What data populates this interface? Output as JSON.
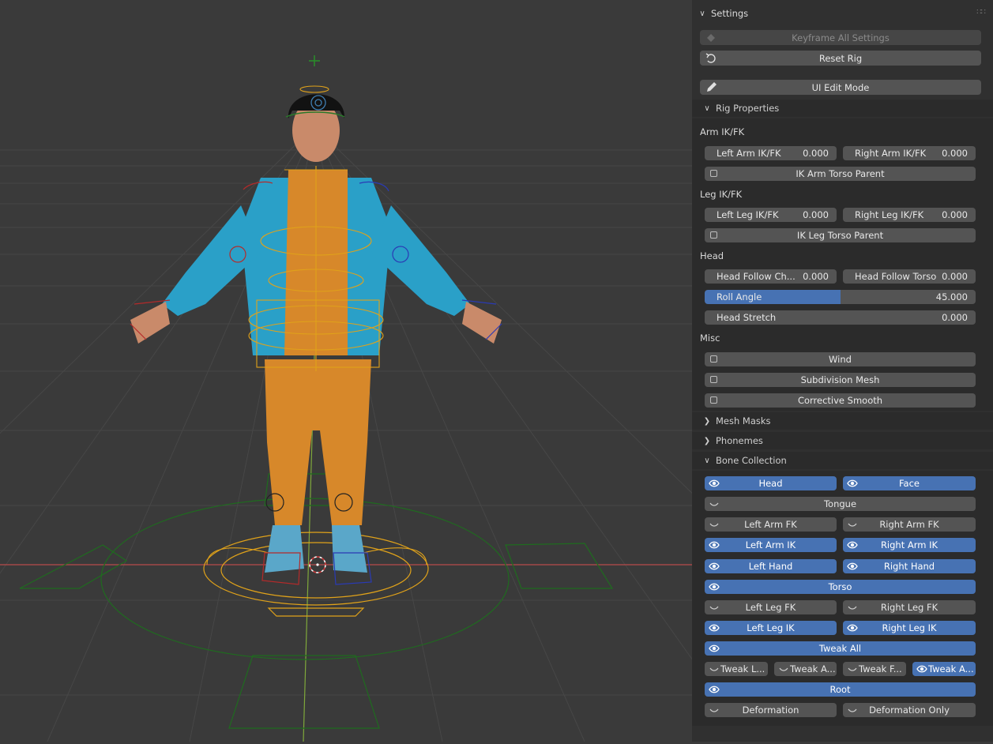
{
  "viewport": {
    "grid_color": "#474747",
    "background": "#3a3a3a",
    "x_axis_color": "#b84a4a",
    "y_axis_color": "#7fa83a"
  },
  "panel": {
    "title": "Settings",
    "grip_icon": "grip-dots-icon",
    "keyframe_all_settings": "Keyframe All Settings",
    "reset_rig": "Reset Rig",
    "ui_edit_mode": "UI Edit Mode",
    "rig_properties": {
      "title": "Rig Properties",
      "arm_section": "Arm IK/FK",
      "left_arm_ikfk": {
        "label": "Left Arm IK/FK",
        "value": "0.000"
      },
      "right_arm_ikfk": {
        "label": "Right Arm IK/FK",
        "value": "0.000"
      },
      "ik_arm_torso_parent": "IK Arm Torso Parent",
      "leg_section": "Leg IK/FK",
      "left_leg_ikfk": {
        "label": "Left Leg IK/FK",
        "value": "0.000"
      },
      "right_leg_ikfk": {
        "label": "Right Leg IK/FK",
        "value": "0.000"
      },
      "ik_leg_torso_parent": "IK Leg Torso Parent",
      "head_section": "Head",
      "head_follow_chest": {
        "label": "Head Follow Ch...",
        "value": "0.000"
      },
      "head_follow_torso": {
        "label": "Head Follow Torso",
        "value": "0.000"
      },
      "roll_angle": {
        "label": "Roll Angle",
        "value": "45.000",
        "fill_fraction": 0.5
      },
      "head_stretch": {
        "label": "Head Stretch",
        "value": "0.000"
      },
      "misc_section": "Misc",
      "wind": "Wind",
      "subdivision_mesh": "Subdivision Mesh",
      "corrective_smooth": "Corrective Smooth"
    },
    "mesh_masks": "Mesh Masks",
    "phonemes": "Phonemes",
    "bone_collection": {
      "title": "Bone Collection",
      "head": {
        "label": "Head",
        "visible": true
      },
      "face": {
        "label": "Face",
        "visible": true
      },
      "tongue": {
        "label": "Tongue",
        "visible": false
      },
      "left_arm_fk": {
        "label": "Left Arm FK",
        "visible": false
      },
      "right_arm_fk": {
        "label": "Right Arm FK",
        "visible": false
      },
      "left_arm_ik": {
        "label": "Left Arm IK",
        "visible": true
      },
      "right_arm_ik": {
        "label": "Right Arm IK",
        "visible": true
      },
      "left_hand": {
        "label": "Left Hand",
        "visible": true
      },
      "right_hand": {
        "label": "Right Hand",
        "visible": true
      },
      "torso": {
        "label": "Torso",
        "visible": true
      },
      "left_leg_fk": {
        "label": "Left Leg FK",
        "visible": false
      },
      "right_leg_fk": {
        "label": "Right Leg FK",
        "visible": false
      },
      "left_leg_ik": {
        "label": "Left Leg IK",
        "visible": true
      },
      "right_leg_ik": {
        "label": "Right Leg IK",
        "visible": true
      },
      "tweak_all": {
        "label": "Tweak All",
        "visible": true
      },
      "tweak_l": {
        "label": "Tweak L...",
        "visible": false
      },
      "tweak_a1": {
        "label": "Tweak A...",
        "visible": false
      },
      "tweak_f": {
        "label": "Tweak F...",
        "visible": false
      },
      "tweak_a2": {
        "label": "Tweak A...",
        "visible": true
      },
      "root": {
        "label": "Root",
        "visible": true
      },
      "deformation": {
        "label": "Deformation",
        "visible": false
      },
      "deformation_only": {
        "label": "Deformation Only",
        "visible": false
      }
    }
  }
}
